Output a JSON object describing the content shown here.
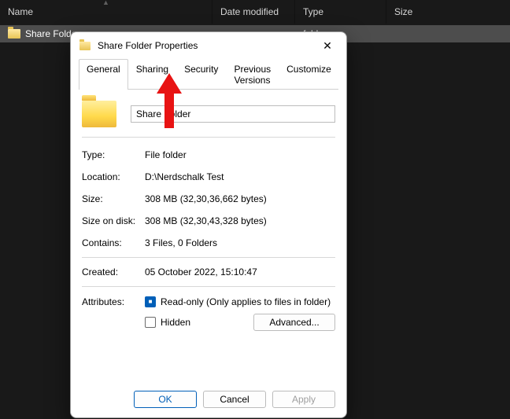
{
  "explorer": {
    "columns": {
      "name": "Name",
      "date": "Date modified",
      "type": "Type",
      "size": "Size"
    },
    "row": {
      "name": "Share Folder",
      "type": "folder"
    }
  },
  "dialog": {
    "title": "Share Folder Properties",
    "tabs": {
      "general": "General",
      "sharing": "Sharing",
      "security": "Security",
      "previous": "Previous Versions",
      "customize": "Customize"
    },
    "folder_name": "Share Folder",
    "fields": {
      "type_label": "Type:",
      "type_value": "File folder",
      "location_label": "Location:",
      "location_value": "D:\\Nerdschalk Test",
      "size_label": "Size:",
      "size_value": "308 MB (32,30,36,662 bytes)",
      "sizeondisk_label": "Size on disk:",
      "sizeondisk_value": "308 MB (32,30,43,328 bytes)",
      "contains_label": "Contains:",
      "contains_value": "3 Files, 0 Folders",
      "created_label": "Created:",
      "created_value": "05 October 2022, 15:10:47",
      "attributes_label": "Attributes:",
      "readonly_label": "Read-only (Only applies to files in folder)",
      "hidden_label": "Hidden",
      "advanced_label": "Advanced..."
    },
    "buttons": {
      "ok": "OK",
      "cancel": "Cancel",
      "apply": "Apply"
    }
  }
}
